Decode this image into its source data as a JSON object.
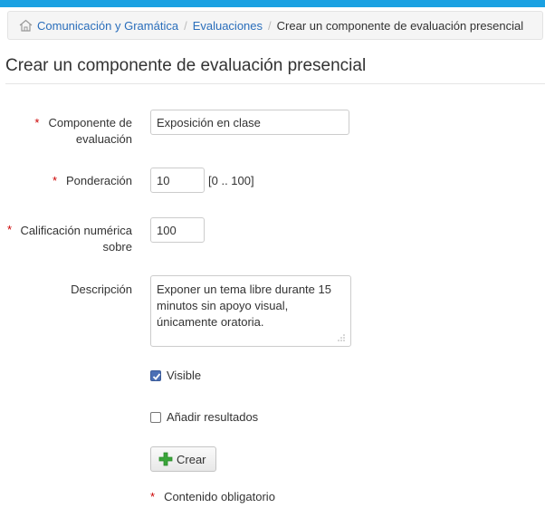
{
  "breadcrumb": {
    "items": [
      "Comunicación y Gramática",
      "Evaluaciones"
    ],
    "separator": "/",
    "current": "Crear un componente de evaluación presencial"
  },
  "page": {
    "title": "Crear un componente de evaluación presencial"
  },
  "form": {
    "required_mark": "*",
    "component": {
      "label_line1": "Componente de",
      "label_line2": "evaluación",
      "value": "Exposición en clase"
    },
    "weight": {
      "label": "Ponderación",
      "value": "10",
      "range": "[0 .. 100]"
    },
    "grade": {
      "label_line1": "Calificación numérica",
      "label_line2": "sobre",
      "value": "100"
    },
    "description": {
      "label": "Descripción",
      "value": "Exponer un tema libre durante 15 minutos sin apoyo visual, únicamente oratoria."
    },
    "visible": {
      "label": "Visible",
      "checked": true
    },
    "add_results": {
      "label": "Añadir resultados",
      "checked": false
    },
    "submit": {
      "label": "Crear",
      "icon": "plus-icon"
    },
    "required_note": "Contenido obligatorio"
  },
  "colors": {
    "accent": "#1ba1e2",
    "link": "#2a6ebb",
    "required": "#cc0000",
    "plus": "#3aa53a"
  }
}
